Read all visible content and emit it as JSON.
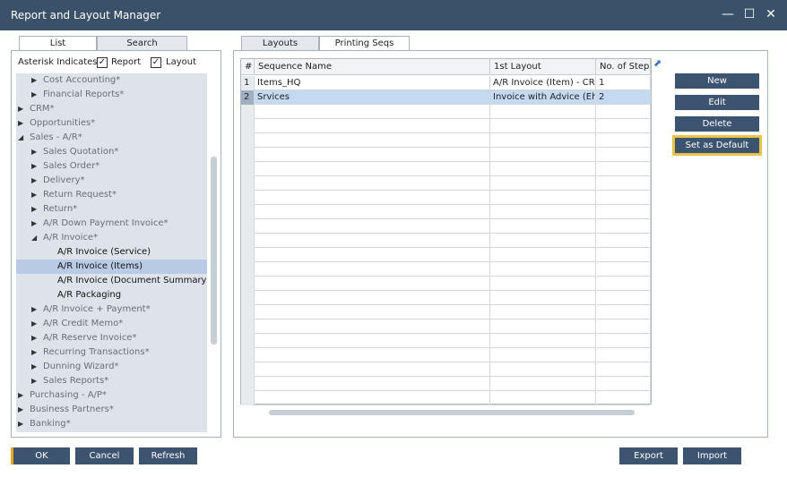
{
  "window": {
    "title": "Report and Layout Manager",
    "minimize_glyph": "—",
    "maximize_glyph": "☐",
    "close_glyph": "✕"
  },
  "left_tabs": [
    {
      "label": "List",
      "active": true
    },
    {
      "label": "Search",
      "active": false
    }
  ],
  "asterisk": {
    "label": "Asterisk Indicates",
    "report_label": "Report",
    "report_checked": true,
    "layout_label": "Layout",
    "layout_checked": true,
    "check_glyph": "✓"
  },
  "tree": [
    {
      "label": "Cost Accounting*",
      "level": 1,
      "expanded": false,
      "dark": false,
      "selected": false
    },
    {
      "label": "Financial Reports*",
      "level": 1,
      "expanded": false,
      "dark": false,
      "selected": false
    },
    {
      "label": "CRM*",
      "level": 0,
      "expanded": false,
      "dark": false,
      "selected": false
    },
    {
      "label": "Opportunities*",
      "level": 0,
      "expanded": false,
      "dark": false,
      "selected": false
    },
    {
      "label": "Sales - A/R*",
      "level": 0,
      "expanded": true,
      "dark": false,
      "selected": false
    },
    {
      "label": "Sales Quotation*",
      "level": 1,
      "expanded": false,
      "dark": false,
      "selected": false
    },
    {
      "label": "Sales Order*",
      "level": 1,
      "expanded": false,
      "dark": false,
      "selected": false
    },
    {
      "label": "Delivery*",
      "level": 1,
      "expanded": false,
      "dark": false,
      "selected": false
    },
    {
      "label": "Return Request*",
      "level": 1,
      "expanded": false,
      "dark": false,
      "selected": false
    },
    {
      "label": "Return*",
      "level": 1,
      "expanded": false,
      "dark": false,
      "selected": false
    },
    {
      "label": "A/R Down Payment Invoice*",
      "level": 1,
      "expanded": false,
      "dark": false,
      "selected": false
    },
    {
      "label": "A/R Invoice*",
      "level": 1,
      "expanded": true,
      "dark": false,
      "selected": false
    },
    {
      "label": "A/R Invoice (Service)",
      "level": 2,
      "leaf": true,
      "dark": true,
      "selected": false
    },
    {
      "label": "A/R Invoice (Items)",
      "level": 2,
      "leaf": true,
      "dark": true,
      "selected": true
    },
    {
      "label": "A/R Invoice (Document Summary)",
      "level": 2,
      "leaf": true,
      "dark": true,
      "selected": false
    },
    {
      "label": "A/R Packaging",
      "level": 2,
      "leaf": true,
      "dark": true,
      "selected": false
    },
    {
      "label": "A/R Invoice + Payment*",
      "level": 1,
      "expanded": false,
      "dark": false,
      "selected": false
    },
    {
      "label": "A/R Credit Memo*",
      "level": 1,
      "expanded": false,
      "dark": false,
      "selected": false
    },
    {
      "label": "A/R Reserve Invoice*",
      "level": 1,
      "expanded": false,
      "dark": false,
      "selected": false
    },
    {
      "label": "Recurring Transactions*",
      "level": 1,
      "expanded": false,
      "dark": false,
      "selected": false
    },
    {
      "label": "Dunning Wizard*",
      "level": 1,
      "expanded": false,
      "dark": false,
      "selected": false
    },
    {
      "label": "Sales Reports*",
      "level": 1,
      "expanded": false,
      "dark": false,
      "selected": false
    },
    {
      "label": "Purchasing - A/P*",
      "level": 0,
      "expanded": false,
      "dark": false,
      "selected": false
    },
    {
      "label": "Business Partners*",
      "level": 0,
      "expanded": false,
      "dark": false,
      "selected": false
    },
    {
      "label": "Banking*",
      "level": 0,
      "expanded": false,
      "dark": false,
      "selected": false
    }
  ],
  "right_tabs": [
    {
      "label": "Layouts",
      "active": false
    },
    {
      "label": "Printing Seqs",
      "active": true
    }
  ],
  "grid": {
    "columns": [
      "#",
      "Sequence Name",
      "1st Layout",
      "No. of Steps"
    ],
    "rows": [
      {
        "num": "1",
        "name": "Items_HQ",
        "layout": "A/R Invoice (Item) - CR (",
        "steps": "1",
        "selected": false
      },
      {
        "num": "2",
        "name": "Srvices",
        "layout": "Invoice with Advice (EhP",
        "steps": "2",
        "selected": true
      }
    ],
    "empty_rows": 21
  },
  "side_buttons": [
    {
      "label": "New",
      "focused": false
    },
    {
      "label": "Edit",
      "focused": false
    },
    {
      "label": "Delete",
      "focused": false
    },
    {
      "label": "Set as Default",
      "focused": true
    }
  ],
  "bottom_buttons": {
    "ok": "OK",
    "cancel": "Cancel",
    "refresh": "Refresh",
    "export": "Export",
    "import": "Import"
  }
}
